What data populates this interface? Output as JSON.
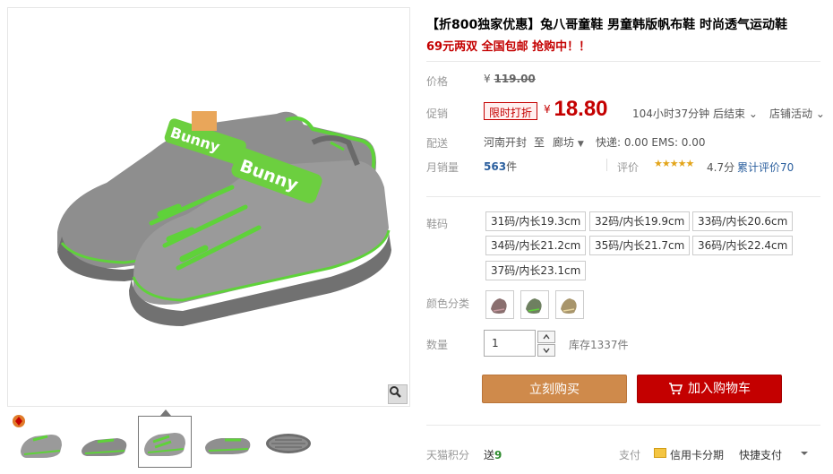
{
  "product": {
    "title": "【折800独家优惠】兔八哥童鞋 男童韩版帆布鞋 时尚透气运动鞋",
    "subtitle": "69元两双 全国包邮 抢购中！！"
  },
  "price": {
    "label": "价格",
    "currency": "¥",
    "original": "119.00"
  },
  "promotion": {
    "label": "促销",
    "tag": "限时打折",
    "currency": "¥",
    "price": "18.80",
    "countdown": "104小时37分钟 后结束",
    "shop_activity": "店铺活动"
  },
  "shipping": {
    "label": "配送",
    "from": "河南开封",
    "to_word": "至",
    "to": "廊坊",
    "fees": "快递: 0.00 EMS: 0.00"
  },
  "sales": {
    "label": "月销量",
    "count": "563",
    "unit": "件",
    "rating_label": "评价",
    "stars": "★★★★★",
    "score": "4.7分",
    "review_count": "累计评价70"
  },
  "sizes": {
    "label": "鞋码",
    "options": [
      "31码/内长19.3cm",
      "32码/内长19.9cm",
      "33码/内长20.6cm",
      "34码/内长21.2cm",
      "35码/内长21.7cm",
      "36码/内长22.4cm",
      "37码/内长23.1cm"
    ]
  },
  "colors": {
    "label": "颜色分类",
    "swatches": [
      "#8a6f6f",
      "#6e8060",
      "#a8956b"
    ]
  },
  "quantity": {
    "label": "数量",
    "value": "1",
    "stock": "库存1337件"
  },
  "actions": {
    "buy_now": "立刻购买",
    "add_to_cart": "加入购物车"
  },
  "footer": {
    "points_label": "天猫积分",
    "points_prefix": "送",
    "points_value": "9",
    "pay_label": "支付",
    "card_installment": "信用卡分期",
    "quick_pay": "快捷支付"
  },
  "colors_theme": {
    "accent_red": "#c40000",
    "buy_orange": "#cf8a4b",
    "link_blue": "#2b5f9e",
    "shoe_green": "#5fd23a"
  }
}
